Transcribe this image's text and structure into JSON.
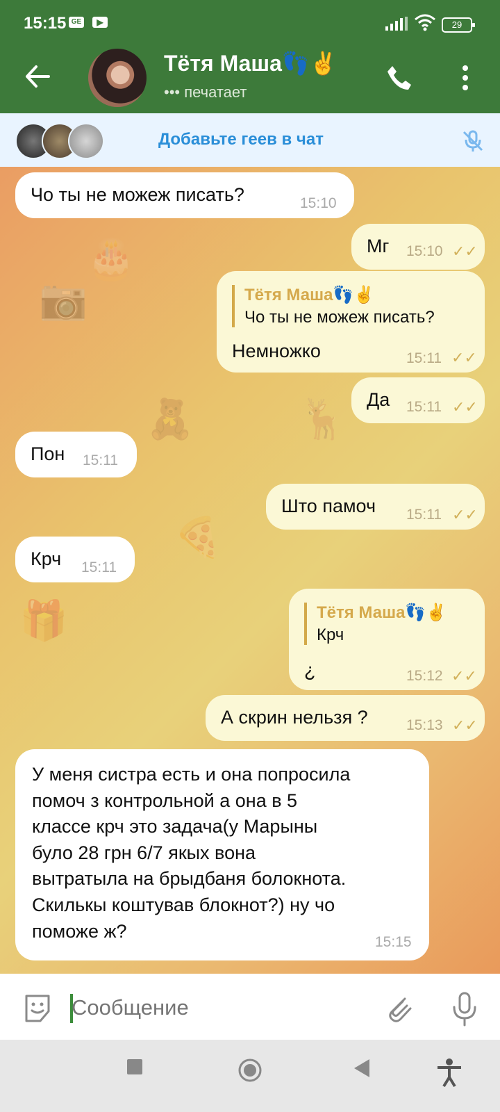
{
  "status": {
    "time": "15:15",
    "battery": "29",
    "mini_icons": [
      "GE",
      "▶"
    ]
  },
  "header": {
    "contact_name": "Тётя Маша👣✌️",
    "status": "••• печатает"
  },
  "banner": {
    "text": "Добавьте геев в чат"
  },
  "messages": [
    {
      "direction": "in",
      "text": "Чо ты не можеж писать?",
      "time": "15:10"
    },
    {
      "direction": "out",
      "text": "Мг",
      "time": "15:10"
    },
    {
      "direction": "out",
      "reply_to": {
        "name": "Тётя Маша👣✌️",
        "text": "Чо ты не можеж писать?"
      },
      "text": "Немножко",
      "time": "15:11"
    },
    {
      "direction": "out",
      "text": "Да",
      "time": "15:11"
    },
    {
      "direction": "in",
      "text": "Пон",
      "time": "15:11"
    },
    {
      "direction": "out",
      "text": "Што памоч",
      "time": "15:11"
    },
    {
      "direction": "in",
      "text": "Крч",
      "time": "15:11"
    },
    {
      "direction": "out",
      "reply_to": {
        "name": "Тётя Маша👣✌️",
        "text": "Крч"
      },
      "text": "¿",
      "time": "15:12"
    },
    {
      "direction": "out",
      "text": "А скрин нельзя ?",
      "time": "15:13"
    },
    {
      "direction": "in",
      "text": "У меня систра есть и она попросила\nпомоч з контрольной а она в 5\nклассе крч это задача(у Марыны\nбуло 28 грн 6/7 якых вона\nвытратыла на брыдбаня болокнота.\nСкилькы коштував блокнот?) ну чо\nпоможе ж?",
      "time": "15:15"
    }
  ],
  "composer": {
    "placeholder": "Сообщение"
  },
  "icons": {
    "back": "back-arrow-icon",
    "call": "phone-icon",
    "menu": "more-vertical-icon",
    "mute": "mute-microphone-icon",
    "sticker": "sticker-icon",
    "attach": "paperclip-icon",
    "voice": "microphone-icon"
  },
  "colors": {
    "header": "#3d7a3a",
    "outgoing_bubble": "#fbf8d6",
    "incoming_bubble": "#ffffff",
    "reply_accent": "#d3a949",
    "banner_text": "#2a8ed8"
  }
}
